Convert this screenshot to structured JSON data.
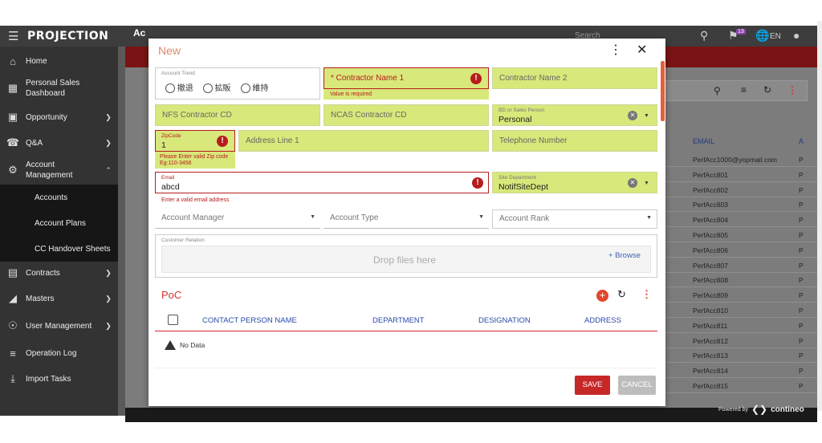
{
  "app": {
    "logo": "PROJECTION",
    "search_placeholder": "Search",
    "notif_count": "13",
    "language": "EN",
    "page_title": "Ac"
  },
  "sidebar": {
    "items": [
      {
        "label": "Home"
      },
      {
        "label": "Personal Sales Dashboard"
      },
      {
        "label": "Opportunity"
      },
      {
        "label": "Q&A"
      },
      {
        "label": "Account Management"
      },
      {
        "label": "Contracts"
      },
      {
        "label": "Masters"
      },
      {
        "label": "User Management"
      },
      {
        "label": "Operation Log"
      },
      {
        "label": "Import Tasks"
      }
    ],
    "subitems": [
      "Accounts",
      "Account Plans",
      "CC Handover Sheets"
    ]
  },
  "table": {
    "email_header": "EMAIL",
    "a_header": "A",
    "rows": [
      {
        "email": "PerfAcc1000@yopmail.com",
        "p": "P"
      },
      {
        "email": "PerfAcc801",
        "p": "P"
      },
      {
        "email": "PerfAcc802",
        "p": "P"
      },
      {
        "email": "PerfAcc803",
        "p": "P"
      },
      {
        "email": "PerfAcc804",
        "p": "P"
      },
      {
        "email": "PerfAcc805",
        "p": "P"
      },
      {
        "email": "PerfAcc806",
        "p": "P"
      },
      {
        "email": "PerfAcc807",
        "p": "P"
      },
      {
        "email": "PerfAcc808",
        "p": "P"
      },
      {
        "email": "PerfAcc809",
        "p": "P"
      },
      {
        "email": "PerfAcc810",
        "p": "P"
      },
      {
        "email": "PerfAcc811",
        "p": "P"
      },
      {
        "email": "PerfAcc812",
        "p": "P"
      },
      {
        "email": "PerfAcc813",
        "p": "P"
      },
      {
        "email": "PerfAcc814",
        "p": "P"
      },
      {
        "email": "PerfAcc815",
        "p": "P"
      }
    ]
  },
  "footer": {
    "powered_by": "Powered by",
    "brand": "contineo"
  },
  "modal": {
    "title": "New",
    "account_trend": {
      "label": "Account Trend",
      "options": [
        "撤退",
        "拡販",
        "維持"
      ]
    },
    "contractor_name_1": {
      "placeholder": "* Contractor Name 1",
      "error": "Value is required"
    },
    "contractor_name_2": {
      "placeholder": "Contractor Name 2"
    },
    "nfs_contractor_cd": {
      "placeholder": "NFS Contractor CD"
    },
    "ncas_contractor_cd": {
      "placeholder": "NCAS Contractor CD"
    },
    "bd_sales_person": {
      "label": "BD or Sales Person",
      "value": "Personal"
    },
    "zipcode": {
      "label": "ZipCode",
      "value": "1",
      "error": "Please Enter valid Zip code Eg:110-3456"
    },
    "address_line_1": {
      "placeholder": "Address Line 1"
    },
    "telephone": {
      "placeholder": "Telephone Number"
    },
    "email": {
      "label": "Email",
      "value": "abcd",
      "error": "Enter a valid email address"
    },
    "site_department": {
      "label": "Site Department",
      "value": "NotifSiteDept"
    },
    "account_manager": {
      "placeholder": "Account Manager"
    },
    "account_type": {
      "placeholder": "Account Type"
    },
    "account_rank": {
      "placeholder": "Account Rank"
    },
    "customer_relation": {
      "label": "Customer Relation",
      "drop_text": "Drop files here",
      "browse": "+ Browse"
    },
    "poc": {
      "title": "PoC",
      "columns": [
        "CONTACT PERSON NAME",
        "DEPARTMENT",
        "DESIGNATION",
        "ADDRESS"
      ],
      "empty": "No Data"
    },
    "save_label": "SAVE",
    "cancel_label": "CANCEL"
  }
}
